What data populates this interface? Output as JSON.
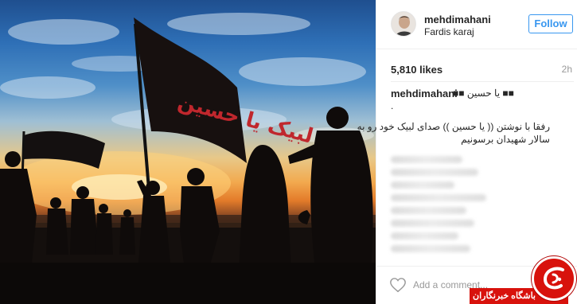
{
  "post": {
    "username": "mehdimahani",
    "location": "Fardis karaj",
    "follow_label": "Follow",
    "likes": "5,810 likes",
    "time": "2h",
    "caption_user": "mehdimahani",
    "caption_title": "■■ یا حسین ■■",
    "caption_dot": ".",
    "caption_lines": [
      "رفقا با نوشتن (( یا حسین )) صدای لبیک خود رو به",
      "سالار شهیدان برسونیم"
    ],
    "comment_placeholder": "Add a comment..."
  },
  "photo": {
    "flag_text": "لبیک یا حسین"
  },
  "watermark": {
    "label": "باشگاه خبرنگاران"
  },
  "colors": {
    "accent": "#3897f0",
    "watermark_red": "#d8120c"
  },
  "icons": {
    "heart": "heart-icon",
    "avatar": "avatar"
  }
}
